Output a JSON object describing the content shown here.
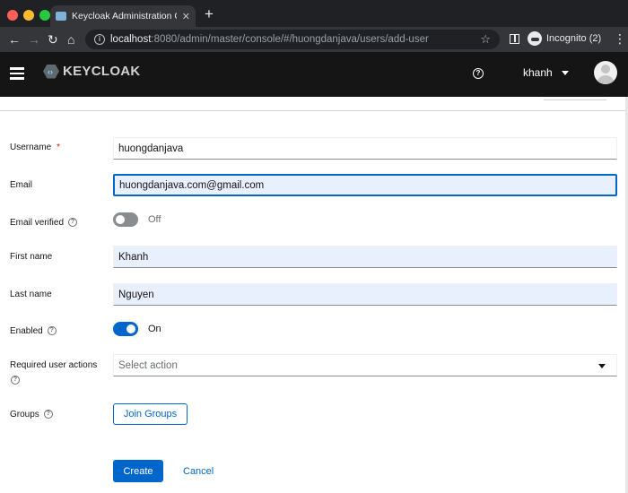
{
  "browser": {
    "tab_title": "Keycloak Administration Console",
    "tab_close": "✕",
    "new_tab": "+",
    "back": "←",
    "forward": "→",
    "reload": "↻",
    "home": "⌂",
    "url_host": "localhost",
    "url_rest": ":8080/admin/master/console/#/huongdanjava/users/add-user",
    "star": "☆",
    "incognito_label": "Incognito (2)",
    "menu": "⋮"
  },
  "header": {
    "logo_text": "KEYCLOAK",
    "help": "?",
    "username": "khanh"
  },
  "form": {
    "username": {
      "label": "Username",
      "required_mark": "*",
      "value": "huongdanjava"
    },
    "email": {
      "label": "Email",
      "value": "huongdanjava.com@gmail.com"
    },
    "email_verified": {
      "label": "Email verified",
      "state_text": "Off",
      "checked": false
    },
    "first_name": {
      "label": "First name",
      "value": "Khanh"
    },
    "last_name": {
      "label": "Last name",
      "value": "Nguyen"
    },
    "enabled": {
      "label": "Enabled",
      "state_text": "On",
      "checked": true
    },
    "required_actions": {
      "label": "Required user actions",
      "placeholder": "Select action"
    },
    "groups": {
      "label": "Groups",
      "button": "Join Groups"
    },
    "help_glyph": "?"
  },
  "actions": {
    "create": "Create",
    "cancel": "Cancel"
  },
  "colors": {
    "primary": "#0066cc",
    "header_bg": "#151515",
    "autofill_bg": "#e8f0fe"
  },
  "icons": [
    "hamburger-icon",
    "help-icon",
    "user-avatar-icon",
    "help-circle-icon",
    "caret-down-icon",
    "info-icon",
    "star-icon"
  ]
}
